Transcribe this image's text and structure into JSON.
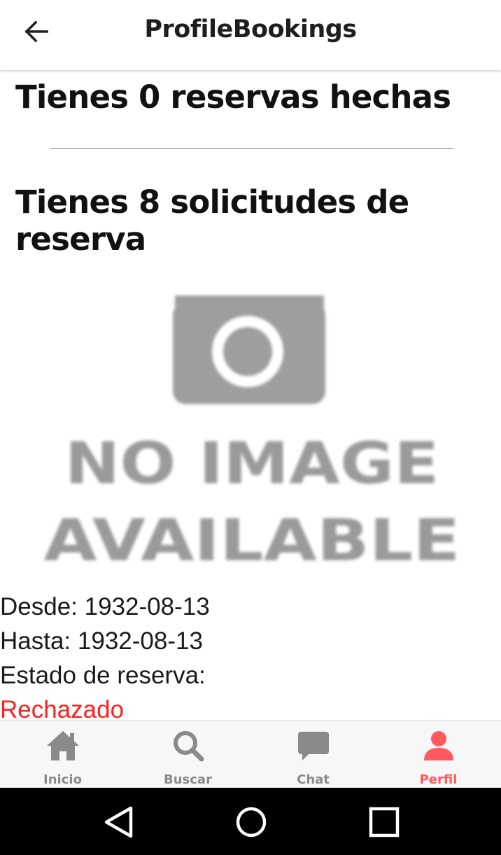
{
  "app_bar": {
    "title": "ProfileBookings",
    "back_icon": "arrow-left-icon"
  },
  "bookings_made": {
    "heading": "Tienes 0 reservas hechas"
  },
  "booking_requests": {
    "heading": "Tienes 8 solicitudes de reserva",
    "items": [
      {
        "image": {
          "line1": "NO IMAGE",
          "line2": "AVAILABLE"
        },
        "from_label": "Desde:",
        "from_value": "1932-08-13",
        "to_label": "Hasta:",
        "to_value": "1932-08-13",
        "status_label": "Estado de reserva:",
        "status_value": "Rechazado",
        "status_color": "#ff1f1f"
      }
    ]
  },
  "bottom_nav": {
    "items": [
      {
        "label": "Inicio",
        "icon": "home-icon",
        "active": false
      },
      {
        "label": "Buscar",
        "icon": "search-icon",
        "active": false
      },
      {
        "label": "Chat",
        "icon": "chat-icon",
        "active": false
      },
      {
        "label": "Perfil",
        "icon": "person-icon",
        "active": true
      }
    ],
    "active_color": "#ff5a5f",
    "inactive_color": "#8a8a8a"
  },
  "system_nav": {
    "buttons": [
      "back-triangle-icon",
      "home-circle-icon",
      "recents-square-icon"
    ]
  }
}
